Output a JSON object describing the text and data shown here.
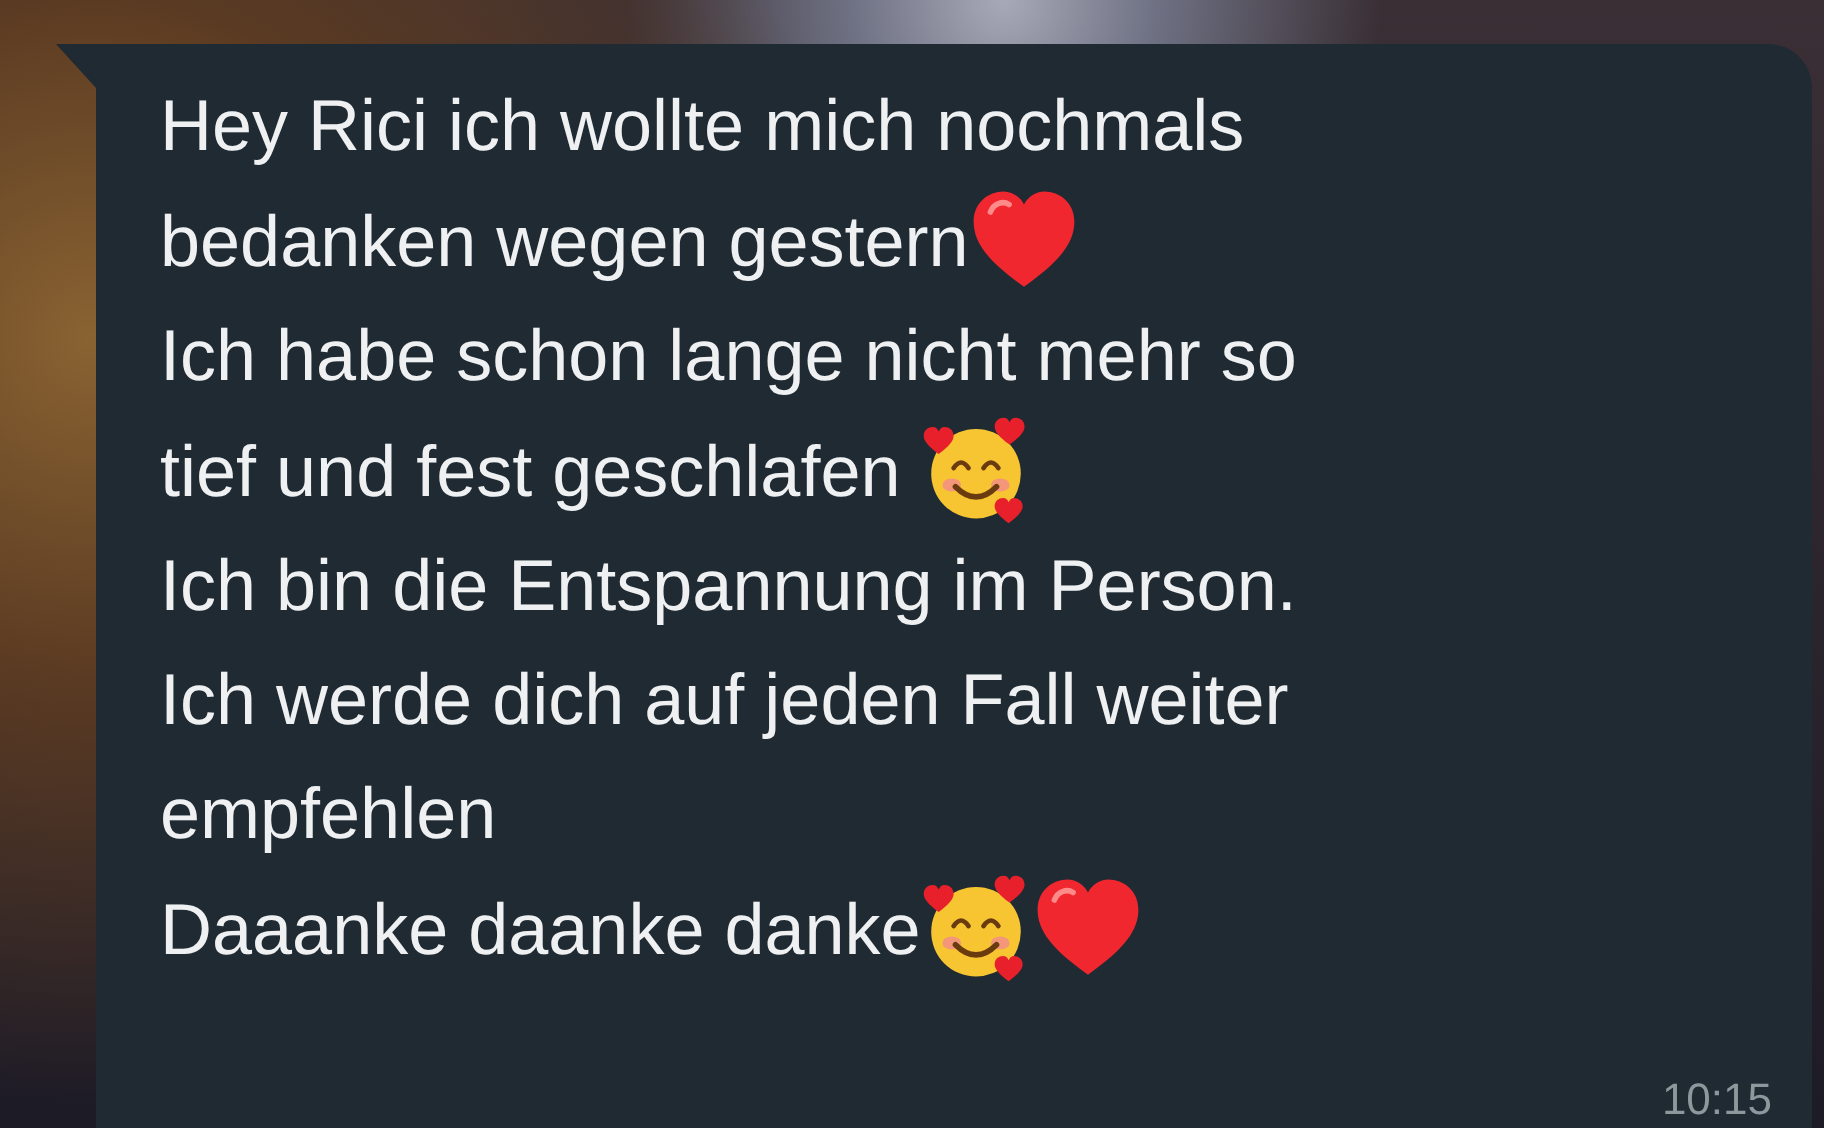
{
  "message": {
    "paragraphs": [
      {
        "lines": [
          "Hey Rici ich wollte mich nochmals",
          "bedanken wegen gestern"
        ],
        "emojis": [
          {
            "kind": "heart"
          }
        ]
      },
      {
        "lines": [
          "Ich habe schon lange nicht mehr so",
          "tief und fest geschlafen "
        ],
        "emojis": [
          {
            "kind": "smiling-hearts"
          }
        ]
      },
      {
        "lines": [
          "Ich bin die Entspannung im Person.",
          "Ich werde dich auf jeden Fall weiter",
          "empfehlen"
        ]
      },
      {
        "lines": [
          "Daaanke daanke danke"
        ],
        "emojis": [
          {
            "kind": "smiling-hearts"
          },
          {
            "kind": "heart"
          }
        ]
      }
    ],
    "time": "10:15"
  }
}
